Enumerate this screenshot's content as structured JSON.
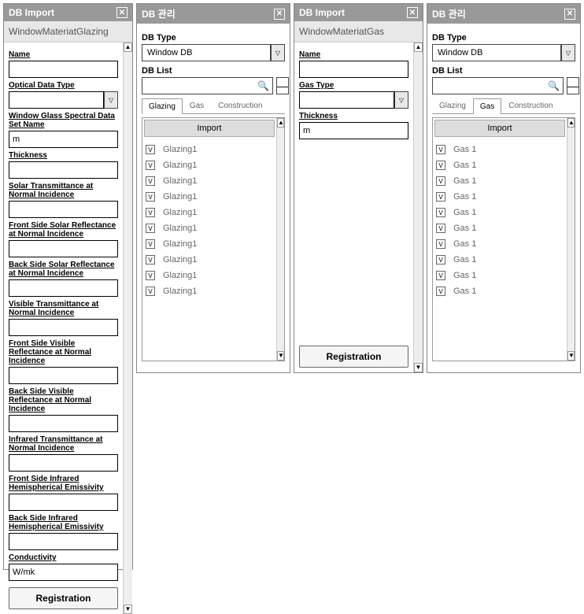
{
  "panel1": {
    "title": "DB Import",
    "subtitle": "WindowMateriatGlazing",
    "fields": [
      {
        "label": "Name",
        "value": ""
      },
      {
        "label": "Optical Data Type",
        "value": "",
        "dropdown": true
      },
      {
        "label": "Window Glass Spectral Data Set Name",
        "value": "m"
      },
      {
        "label": "Thickness",
        "value": ""
      },
      {
        "label": "Solar Transmittance at Normal Incidence",
        "value": ""
      },
      {
        "label": "Front Side Solar Reflectance at Normal Incidence",
        "value": ""
      },
      {
        "label": "Back Side Solar Reflectance at Normal Incidence",
        "value": ""
      },
      {
        "label": "Visible Transmittance at Normal Incidence",
        "value": ""
      },
      {
        "label": "Front Side Visible Reflectance at Normal Incidence",
        "value": ""
      },
      {
        "label": "Back Side Visible Reflectance at Normal Incidence",
        "value": ""
      },
      {
        "label": "Infrared Transmittance at Normal Incidence",
        "value": ""
      },
      {
        "label": "Front Side Infrared Hemispherical Emissivity",
        "value": ""
      },
      {
        "label": "Back Side Infrared Hemispherical Emissivity",
        "value": ""
      },
      {
        "label": "Conductivity",
        "value": "W/mk"
      }
    ],
    "register": "Registration"
  },
  "panel2": {
    "title": "DB 관리",
    "dbtype_label": "DB Type",
    "dbtype_value": "Window DB",
    "dblist_label": "DB List",
    "search_value": "",
    "tabs": [
      "Glazing",
      "Gas",
      "Construction"
    ],
    "active_tab": 0,
    "import_header": "Import",
    "items": [
      "Glazing1",
      "Glazing1",
      "Glazing1",
      "Glazing1",
      "Glazing1",
      "Glazing1",
      "Glazing1",
      "Glazing1",
      "Glazing1",
      "Glazing1"
    ]
  },
  "panel3": {
    "title": "DB Import",
    "subtitle": "WindowMateriatGas",
    "fields": [
      {
        "label": "Name",
        "value": ""
      },
      {
        "label": "Gas Type",
        "value": "",
        "dropdown": true
      },
      {
        "label": "Thickness",
        "value": "m"
      }
    ],
    "register": "Registration"
  },
  "panel4": {
    "title": "DB 관리",
    "dbtype_label": "DB Type",
    "dbtype_value": "Window DB",
    "dblist_label": "DB List",
    "search_value": "",
    "tabs": [
      "Glazing",
      "Gas",
      "Construction"
    ],
    "active_tab": 1,
    "import_header": "Import",
    "items": [
      "Gas 1",
      "Gas 1",
      "Gas 1",
      "Gas 1",
      "Gas 1",
      "Gas 1",
      "Gas 1",
      "Gas 1",
      "Gas 1",
      "Gas 1"
    ]
  }
}
